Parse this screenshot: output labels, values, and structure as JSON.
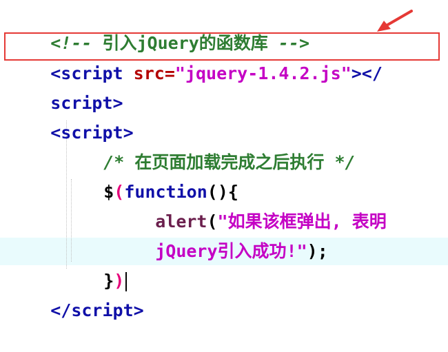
{
  "editor": {
    "line1": {
      "comment_open": "<!-- ",
      "comment_text": "引入jQuery的函数库",
      "comment_close": " -->"
    },
    "line2": {
      "open": "<",
      "tag": "script",
      "attr": "src",
      "eq": "=",
      "value": "\"jquery-1.4.2.js\"",
      "close": "></"
    },
    "line3": {
      "tag": "script",
      "close": ">"
    },
    "line4": {
      "open": "<",
      "tag": "script",
      "close": ">"
    },
    "line5": {
      "comment_open": "/* ",
      "comment_text": "在页面加载完成之后执行",
      "comment_close": " */"
    },
    "line6": {
      "dollar": "$",
      "paren_open": "(",
      "keyword": "function",
      "rest": "(){"
    },
    "line7": {
      "fn": "alert",
      "paren": "(",
      "string": "\"如果该框弹出, 表明"
    },
    "line8": {
      "string": "jQuery引入成功!\"",
      "rest": ");"
    },
    "line9": {
      "brace": "}",
      "paren_close": ")"
    },
    "line10": {
      "open": "</",
      "tag": "script",
      "close": ">"
    }
  },
  "colors": {
    "annotation_box": "#e53935",
    "arrow": "#e53935",
    "current_line": "#e9fbfd"
  },
  "icons": {
    "annotation": "arrow-icon"
  }
}
